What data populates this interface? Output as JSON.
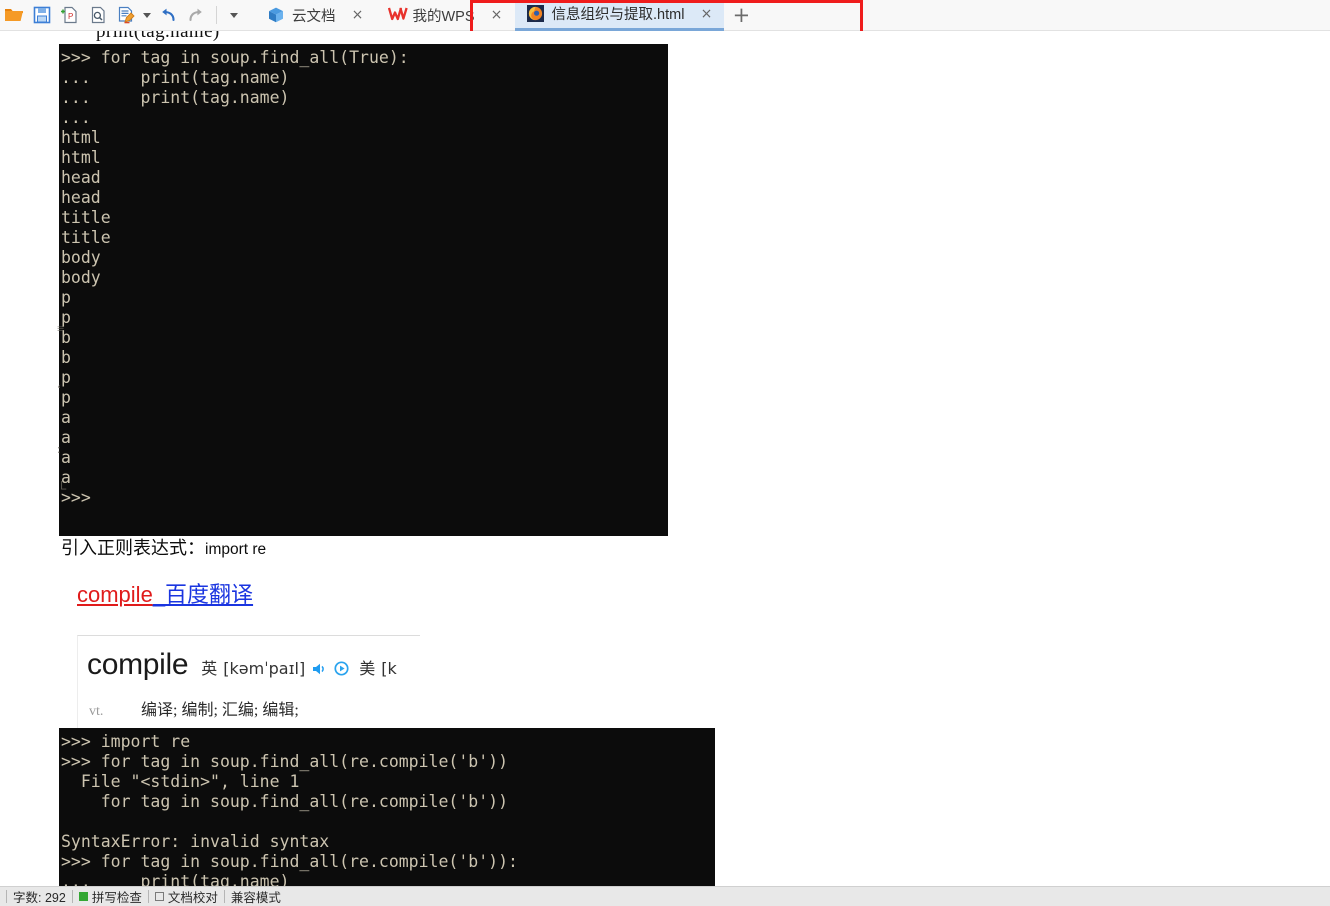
{
  "toolbar": {
    "icons": [
      {
        "name": "open-folder-icon",
        "label": "打开"
      },
      {
        "name": "save-icon",
        "label": "保存"
      },
      {
        "name": "export-pdf-icon",
        "label": "输出为PDF"
      },
      {
        "name": "print-preview-icon",
        "label": "打印预览"
      },
      {
        "name": "document-edit-icon",
        "label": "文档编辑"
      },
      {
        "name": "undo-icon",
        "label": "撤销"
      },
      {
        "name": "redo-icon",
        "label": "恢复"
      }
    ]
  },
  "tabs": [
    {
      "label": "云文档",
      "icon": "cloud-doc-icon",
      "active": false,
      "closable": true
    },
    {
      "label": "我的WPS",
      "icon": "wps-logo-icon",
      "active": false,
      "closable": true
    },
    {
      "label": "信息组织与提取.html",
      "icon": "firefox-icon",
      "active": true,
      "closable": true
    }
  ],
  "new_tab_label": "+",
  "close_glyph": "×",
  "annotation": {
    "name": "red-highlight-box",
    "color": "#ef1c1c"
  },
  "document": {
    "clipped_top_line": "print(tag.name)",
    "terminal1": {
      "lines": [
        ">>> for tag in soup.find_all(True):",
        "...     print(tag.name)",
        "...     print(tag.name)",
        "...",
        "html",
        "html",
        "head",
        "head",
        "title",
        "title",
        "body",
        "body",
        "p",
        "p",
        "b",
        "b",
        "p",
        "p",
        "a",
        "a",
        "a",
        "a",
        ">>>"
      ]
    },
    "paragraph_import": {
      "cn": "引入正则表达式：",
      "code": "import re"
    },
    "link": {
      "red_part": "compile",
      "blue_part": "_百度翻译"
    },
    "dict_card": {
      "word": "compile",
      "uk_label": "英",
      "uk_phonetic": "[kəmˈpaɪl]",
      "us_label": "美",
      "us_phonetic": "[k",
      "pos": "vt.",
      "definition": "编译; 编制; 汇编; 编辑;"
    },
    "terminal2": {
      "lines": [
        ">>> import re",
        ">>> for tag in soup.find_all(re.compile('b'))",
        "  File \"<stdin>\", line 1",
        "    for tag in soup.find_all(re.compile('b'))",
        "",
        "SyntaxError: invalid syntax",
        ">>> for tag in soup.find_all(re.compile('b')):",
        "...     print(tag.name)"
      ]
    }
  },
  "status_bar": {
    "word_count": "字数: 292",
    "spell_check": "拼写检查",
    "doc_proof": "文档校对",
    "compat_mode": "兼容模式"
  }
}
